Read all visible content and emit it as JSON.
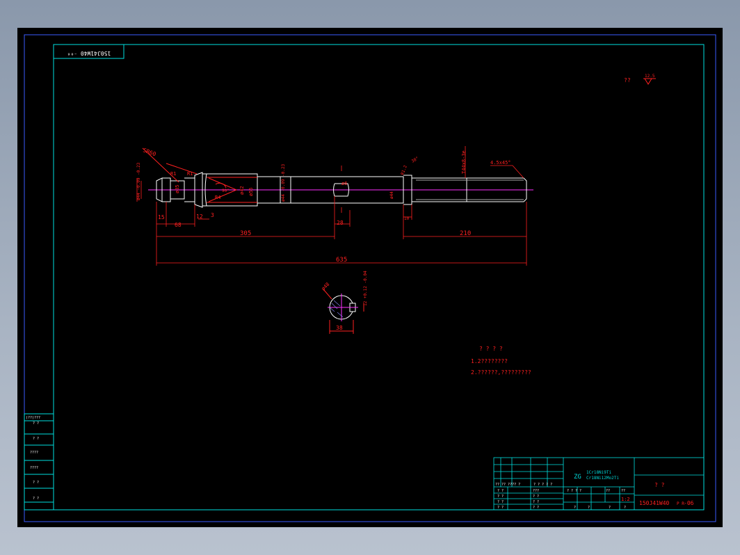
{
  "frame_code_rotated": "150J41W40 ⁻⁰⁶",
  "roughness_note": "??",
  "roughness_symbol_value": "12.5",
  "dimensions": {
    "sr": "SR60",
    "d_left": "ø44 -0.09 -0.23",
    "d_groove": "ø35",
    "d_mid": "ø42",
    "d_body": "ø55",
    "d_shaft": "ø44 -0.09 -0.23",
    "d_small": "ø6",
    "d_right": "ø44",
    "thread": "T44x8-3e",
    "angle_90": "90°",
    "r1": "R1",
    "r1b": "R1",
    "r1_2": "R1.2",
    "r4": "R4",
    "angle_30": "30°",
    "chamfer": "4.5x45°",
    "dim_15": "15",
    "dim_68": "68",
    "dim_12": "12",
    "dim_3": "3",
    "dim_28": "28",
    "dim_10": "10",
    "dim_305": "305",
    "dim_210": "210",
    "dim_635": "635",
    "dim_38": "38",
    "sec_dia": "ø48",
    "sec_12": "12 +0.12 -0.04"
  },
  "notes": {
    "title": "? ? ? ?",
    "line1": "1.2????????",
    "line2": "2.??????,?????????"
  },
  "left_strip": [
    "(??)???",
    "? ?",
    "? ?",
    "????",
    "????",
    "? ?",
    "? ?"
  ],
  "title_block": {
    "material_label": "ZG",
    "material_line1": "1Cr18Ni9Ti",
    "material_line2": "Cr18Ni12Mo2Ti",
    "name": "?      ?",
    "scale": "1:2",
    "drawing_no": "150J41W40",
    "drawing_suffix": "-06",
    "drawing_sub": "P R",
    "change_headers": [
      "?? ?? ???? ?",
      "? ? ? ? ?"
    ],
    "sign_rows": [
      "? ?",
      "? ?",
      "? ?",
      "? ?"
    ],
    "sign_rows2": [
      "???",
      "? ?",
      "? ?",
      "? ?"
    ],
    "attr_row": [
      "? ? ? ?",
      "??",
      "??",
      "??"
    ],
    "attr_row2": [
      "?",
      "?",
      "?",
      "?"
    ]
  }
}
